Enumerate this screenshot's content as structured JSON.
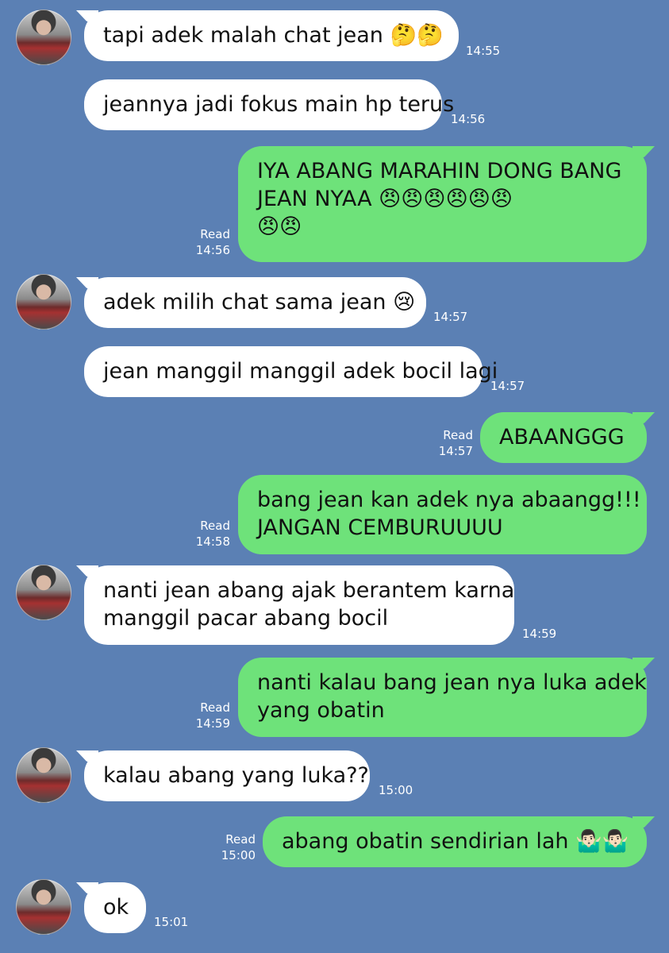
{
  "messages": [
    {
      "side": "in",
      "text": "tapi adek malah chat jean 🤔🤔",
      "time": "14:55"
    },
    {
      "side": "in",
      "text": "jeannya jadi fokus main hp terus",
      "time": "14:56"
    },
    {
      "side": "out",
      "lines": [
        "IYA ABANG MARAHIN DONG BANG",
        "JEAN NYAA 😠😠😠😠😠😠",
        "😠😠"
      ],
      "read": "Read",
      "time": "14:56"
    },
    {
      "side": "in",
      "text": "adek milih chat sama jean 😢",
      "time": "14:57"
    },
    {
      "side": "in",
      "text": "jean manggil manggil adek bocil lagi",
      "time": "14:57"
    },
    {
      "side": "out",
      "text": "ABAANGGG",
      "read": "Read",
      "time": "14:57"
    },
    {
      "side": "out",
      "lines": [
        "bang jean kan adek nya abaangg!!!",
        "JANGAN CEMBURUUUU"
      ],
      "read": "Read",
      "time": "14:58"
    },
    {
      "side": "in",
      "lines": [
        "nanti jean abang ajak berantem karna",
        "manggil pacar abang bocil"
      ],
      "time": "14:59"
    },
    {
      "side": "out",
      "lines": [
        "nanti kalau bang jean nya luka adek",
        "yang obatin"
      ],
      "read": "Read",
      "time": "14:59"
    },
    {
      "side": "in",
      "text": "kalau abang yang luka??",
      "time": "15:00"
    },
    {
      "side": "out",
      "text": "abang obatin sendirian lah 🤷🏻‍♂️🤷🏻‍♂️",
      "read": "Read",
      "time": "15:00"
    },
    {
      "side": "in",
      "text": "ok",
      "time": "15:01"
    }
  ]
}
